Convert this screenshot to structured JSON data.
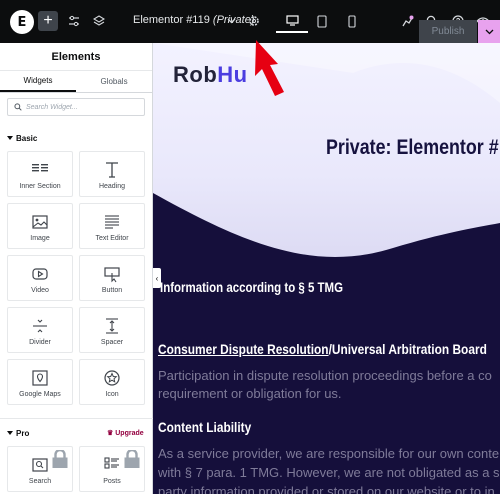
{
  "topbar": {
    "logo_glyph": "E",
    "add_glyph": "+",
    "doc_title": "Elementor #119",
    "doc_status": "(Private)",
    "publish_label": "Publish",
    "icons": [
      "elementor-logo-icon",
      "plus-icon",
      "sliders-icon",
      "layers-icon",
      "chevron-down-icon",
      "gear-icon",
      "desktop-icon",
      "tablet-icon",
      "mobile-icon",
      "notifications-icon",
      "search-icon",
      "help-icon",
      "eye-icon"
    ]
  },
  "panel": {
    "title": "Elements",
    "tabs": [
      "Widgets",
      "Globals"
    ],
    "search_placeholder": "Search Widget...",
    "basic_label": "Basic",
    "pro_label": "Pro",
    "upgrade_label": "Upgrade",
    "widgets": [
      {
        "label": "Inner Section",
        "icon": "inner-section-icon"
      },
      {
        "label": "Heading",
        "icon": "heading-icon"
      },
      {
        "label": "Image",
        "icon": "image-icon"
      },
      {
        "label": "Text Editor",
        "icon": "text-editor-icon"
      },
      {
        "label": "Video",
        "icon": "video-icon"
      },
      {
        "label": "Button",
        "icon": "button-icon"
      },
      {
        "label": "Divider",
        "icon": "divider-icon"
      },
      {
        "label": "Spacer",
        "icon": "spacer-icon"
      },
      {
        "label": "Google Maps",
        "icon": "google-maps-icon"
      },
      {
        "label": "Icon",
        "icon": "star-icon"
      }
    ],
    "pro_widgets": [
      {
        "label": "Search",
        "icon": "search-widget-icon"
      },
      {
        "label": "Posts",
        "icon": "posts-icon"
      }
    ]
  },
  "canvas": {
    "logo_a": "Rob",
    "logo_b": "Hu",
    "page_heading": "Private: Elementor #",
    "h_info": "Information according to § 5 TMG",
    "h_consumer_underlined": "Consumer Dispute Resolution",
    "h_consumer_rest": "/Universal Arbitration Board",
    "p1_line1": "Participation in dispute resolution proceedings before a co",
    "p1_line2": "requirement or obligation for us.",
    "h_content": "Content Liability",
    "p2_line1": "As a service provider, we are responsible for our own conte",
    "p2_line2": "with § 7 para. 1 TMG. However, we are not obligated as a s",
    "p2_line3": "party information provided or stored on our website or to in"
  },
  "colors": {
    "topbar_bg": "#0c0d0e",
    "publish_caret": "#e8a2ee",
    "upgrade": "#93003f",
    "canvas_dark": "#150f3b",
    "arrow": "#e60012"
  }
}
